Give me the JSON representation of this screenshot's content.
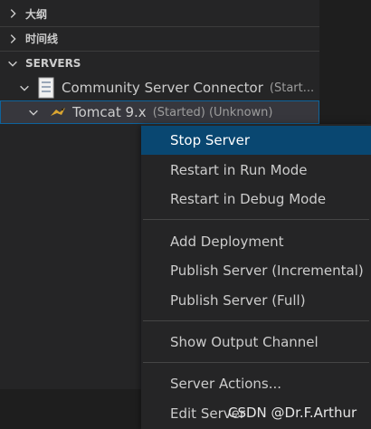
{
  "sections": {
    "outline_label": "大纲",
    "timeline_label": "时间线",
    "servers_label": "SERVERS"
  },
  "tree": {
    "connector": {
      "label": "Community Server Connector",
      "status": "(Start..."
    },
    "tomcat": {
      "label": "Tomcat 9.x",
      "status": "(Started) (Unknown)"
    }
  },
  "context_menu": {
    "items": [
      "Stop Server",
      "Restart in Run Mode",
      "Restart in Debug Mode",
      "Add Deployment",
      "Publish Server (Incremental)",
      "Publish Server (Full)",
      "Show Output Channel",
      "Server Actions...",
      "Edit Server"
    ]
  },
  "watermark": "CSDN @Dr.F.Arthur",
  "colors": {
    "menu_active": "#094771",
    "selection_border": "#0e639c",
    "background": "#252526"
  }
}
